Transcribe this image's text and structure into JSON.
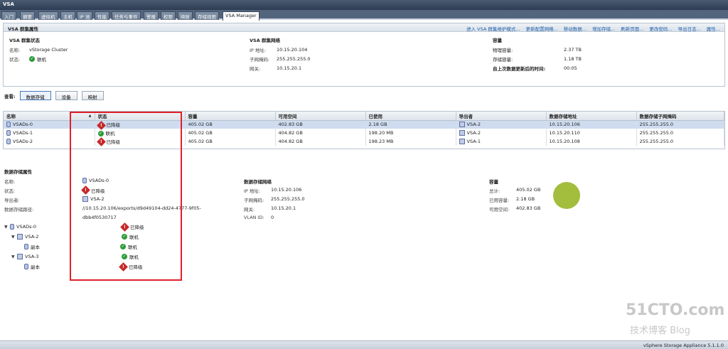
{
  "app": {
    "title": "VSA",
    "version": "vSphere Storage Appliance 5.1.1.0"
  },
  "tabs": [
    "入门",
    "摘要",
    "虚拟机",
    "主机",
    "IP 池",
    "性能",
    "任务与事件",
    "警报",
    "权限",
    "映射",
    "存储视图",
    "VSA Manager"
  ],
  "cluster": {
    "panel_title": "VSA 群集属性",
    "links": [
      "进入 VSA 群集维护模式...",
      "更新配置网络...",
      "移动数据...",
      "增加存储...",
      "刷新页面...",
      "更改密码...",
      "导出日志...",
      "属性..."
    ],
    "status": {
      "header": "VSA 群集状态",
      "name_label": "名称:",
      "name": "vStorage Cluster",
      "state_label": "状态:",
      "state": "联机"
    },
    "network": {
      "header": "VSA 群集网络",
      "ip_label": "IP 地址:",
      "ip": "10.15.20.104",
      "mask_label": "子网掩码:",
      "mask": "255.255.255.0",
      "gw_label": "网关:",
      "gw": "10.15.20.1"
    },
    "capacity": {
      "header": "容量",
      "phys_label": "物理容量:",
      "phys": "2.37 TB",
      "store_label": "存储容量:",
      "store": "1.18 TB",
      "last_label": "自上次数据更新后的时间:",
      "last": "00:05"
    }
  },
  "viewbar": {
    "label": "查看:",
    "buttons": [
      "数据存储",
      "设备",
      "映射"
    ]
  },
  "grid": {
    "headers": [
      "名称",
      "状态",
      "容量",
      "可用空间",
      "已使用",
      "导出者",
      "数据存储地址",
      "数据存储子网掩码"
    ],
    "rows": [
      {
        "name": "VSADs-0",
        "status": "已降级",
        "status_type": "warn",
        "capacity": "405.02 GB",
        "free": "402.83 GB",
        "used": "2.18 GB",
        "exporter": "VSA-2",
        "address": "10.15.20.106",
        "mask": "255.255.255.0"
      },
      {
        "name": "VSADs-1",
        "status": "联机",
        "status_type": "ok",
        "capacity": "405.02 GB",
        "free": "404.82 GB",
        "used": "198.20 MB",
        "exporter": "VSA-2",
        "address": "10.15.20.110",
        "mask": "255.255.255.0"
      },
      {
        "name": "VSADs-2",
        "status": "已降级",
        "status_type": "warn",
        "capacity": "405.02 GB",
        "free": "404.82 GB",
        "used": "198.23 MB",
        "exporter": "VSA-1",
        "address": "10.15.20.108",
        "mask": "255.255.255.0"
      }
    ]
  },
  "props": {
    "title": "数据存储属性",
    "name_label": "名称:",
    "name": "VSADs-0",
    "state_label": "状态:",
    "state": "已降级",
    "exporter_label": "导出者:",
    "exporter": "VSA-2",
    "path_label": "数据存储路径:",
    "path1": "//10.15.20.106/exports/d9d49104-dd24-4777-9f05-",
    "path2": "dbb4f0530717",
    "net_header": "数据存储网络",
    "ip_label": "IP 地址:",
    "ip": "10.15.20.106",
    "mask_label": "子网掩码:",
    "mask": "255.255.255.0",
    "gw_label": "网关:",
    "gw": "10.15.20.1",
    "vlan_label": "VLAN ID:",
    "vlan": "0",
    "cap_header": "容量",
    "total_label": "总计:",
    "total": "405.02 GB",
    "used_label": "已用容量:",
    "used": "2.18 GB",
    "free_label": "可用空间:",
    "free": "402.83 GB",
    "used_fraction": 0.0054
  },
  "tree": [
    {
      "label": "VSADs-0",
      "status": "已降级"
    },
    {
      "label": "VSA-2",
      "status": "联机"
    },
    {
      "label": "副本",
      "status": "联机"
    },
    {
      "label": "VSA-3",
      "status": "联机"
    },
    {
      "label": "副本",
      "status": "已降级"
    }
  ],
  "watermark": {
    "line1": "51CTO.com",
    "line2": "技术博客  Blog"
  }
}
